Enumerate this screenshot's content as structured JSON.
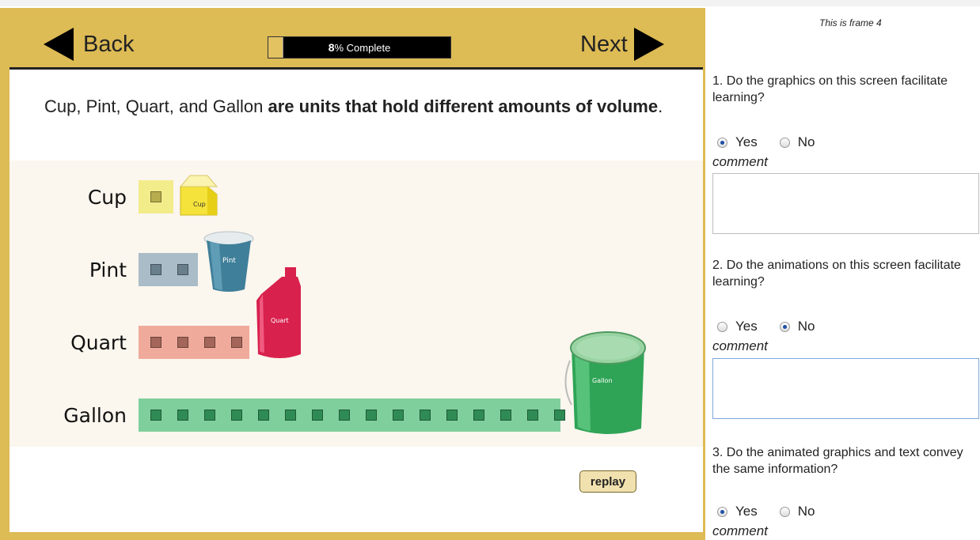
{
  "lesson": {
    "back_label": "Back",
    "next_label": "Next",
    "progress": {
      "percent": 8,
      "number_label": "8",
      "suffix_label": "% Complete"
    },
    "intro_plain": "Cup, Pint, Quart, and Gallon ",
    "intro_bold": "are units that hold different amounts of volume",
    "intro_end": ".",
    "units": [
      {
        "label": "Cup",
        "squares": 1,
        "container_label": "Cup",
        "bar_color": "#f3ec8a",
        "square_color": "#b7ad4f"
      },
      {
        "label": "Pint",
        "squares": 2,
        "container_label": "Pint",
        "bar_color": "#a9bcc7",
        "square_color": "#6a7f8c"
      },
      {
        "label": "Quart",
        "squares": 4,
        "container_label": "Quart",
        "bar_color": "#f0aa9b",
        "square_color": "#a46659"
      },
      {
        "label": "Gallon",
        "squares": 16,
        "container_label": "Gallon",
        "bar_color": "#7fcf9c",
        "square_color": "#2f8b54"
      }
    ],
    "replay_label": "replay"
  },
  "survey": {
    "frame_label": "This is frame 4",
    "questions": [
      {
        "text": "1. Do the graphics on this screen facilitate learning?",
        "yes": "Yes",
        "no": "No",
        "selected": "yes",
        "comment_label": "comment",
        "comment_value": ""
      },
      {
        "text": "2. Do the animations on this screen facilitate learning?",
        "yes": "Yes",
        "no": "No",
        "selected": "no",
        "comment_label": "comment",
        "comment_value": ""
      },
      {
        "text": "3. Do the animated graphics and text convey the same information?",
        "yes": "Yes",
        "no": "No",
        "selected": "yes",
        "comment_label": "comment"
      }
    ]
  },
  "colors": {
    "frame_gold": "#ddbb55",
    "cup_yellow": "#f5e23a",
    "pint_blue": "#3f7f9a",
    "quart_red": "#d8214d",
    "gallon_green": "#2fa456"
  }
}
